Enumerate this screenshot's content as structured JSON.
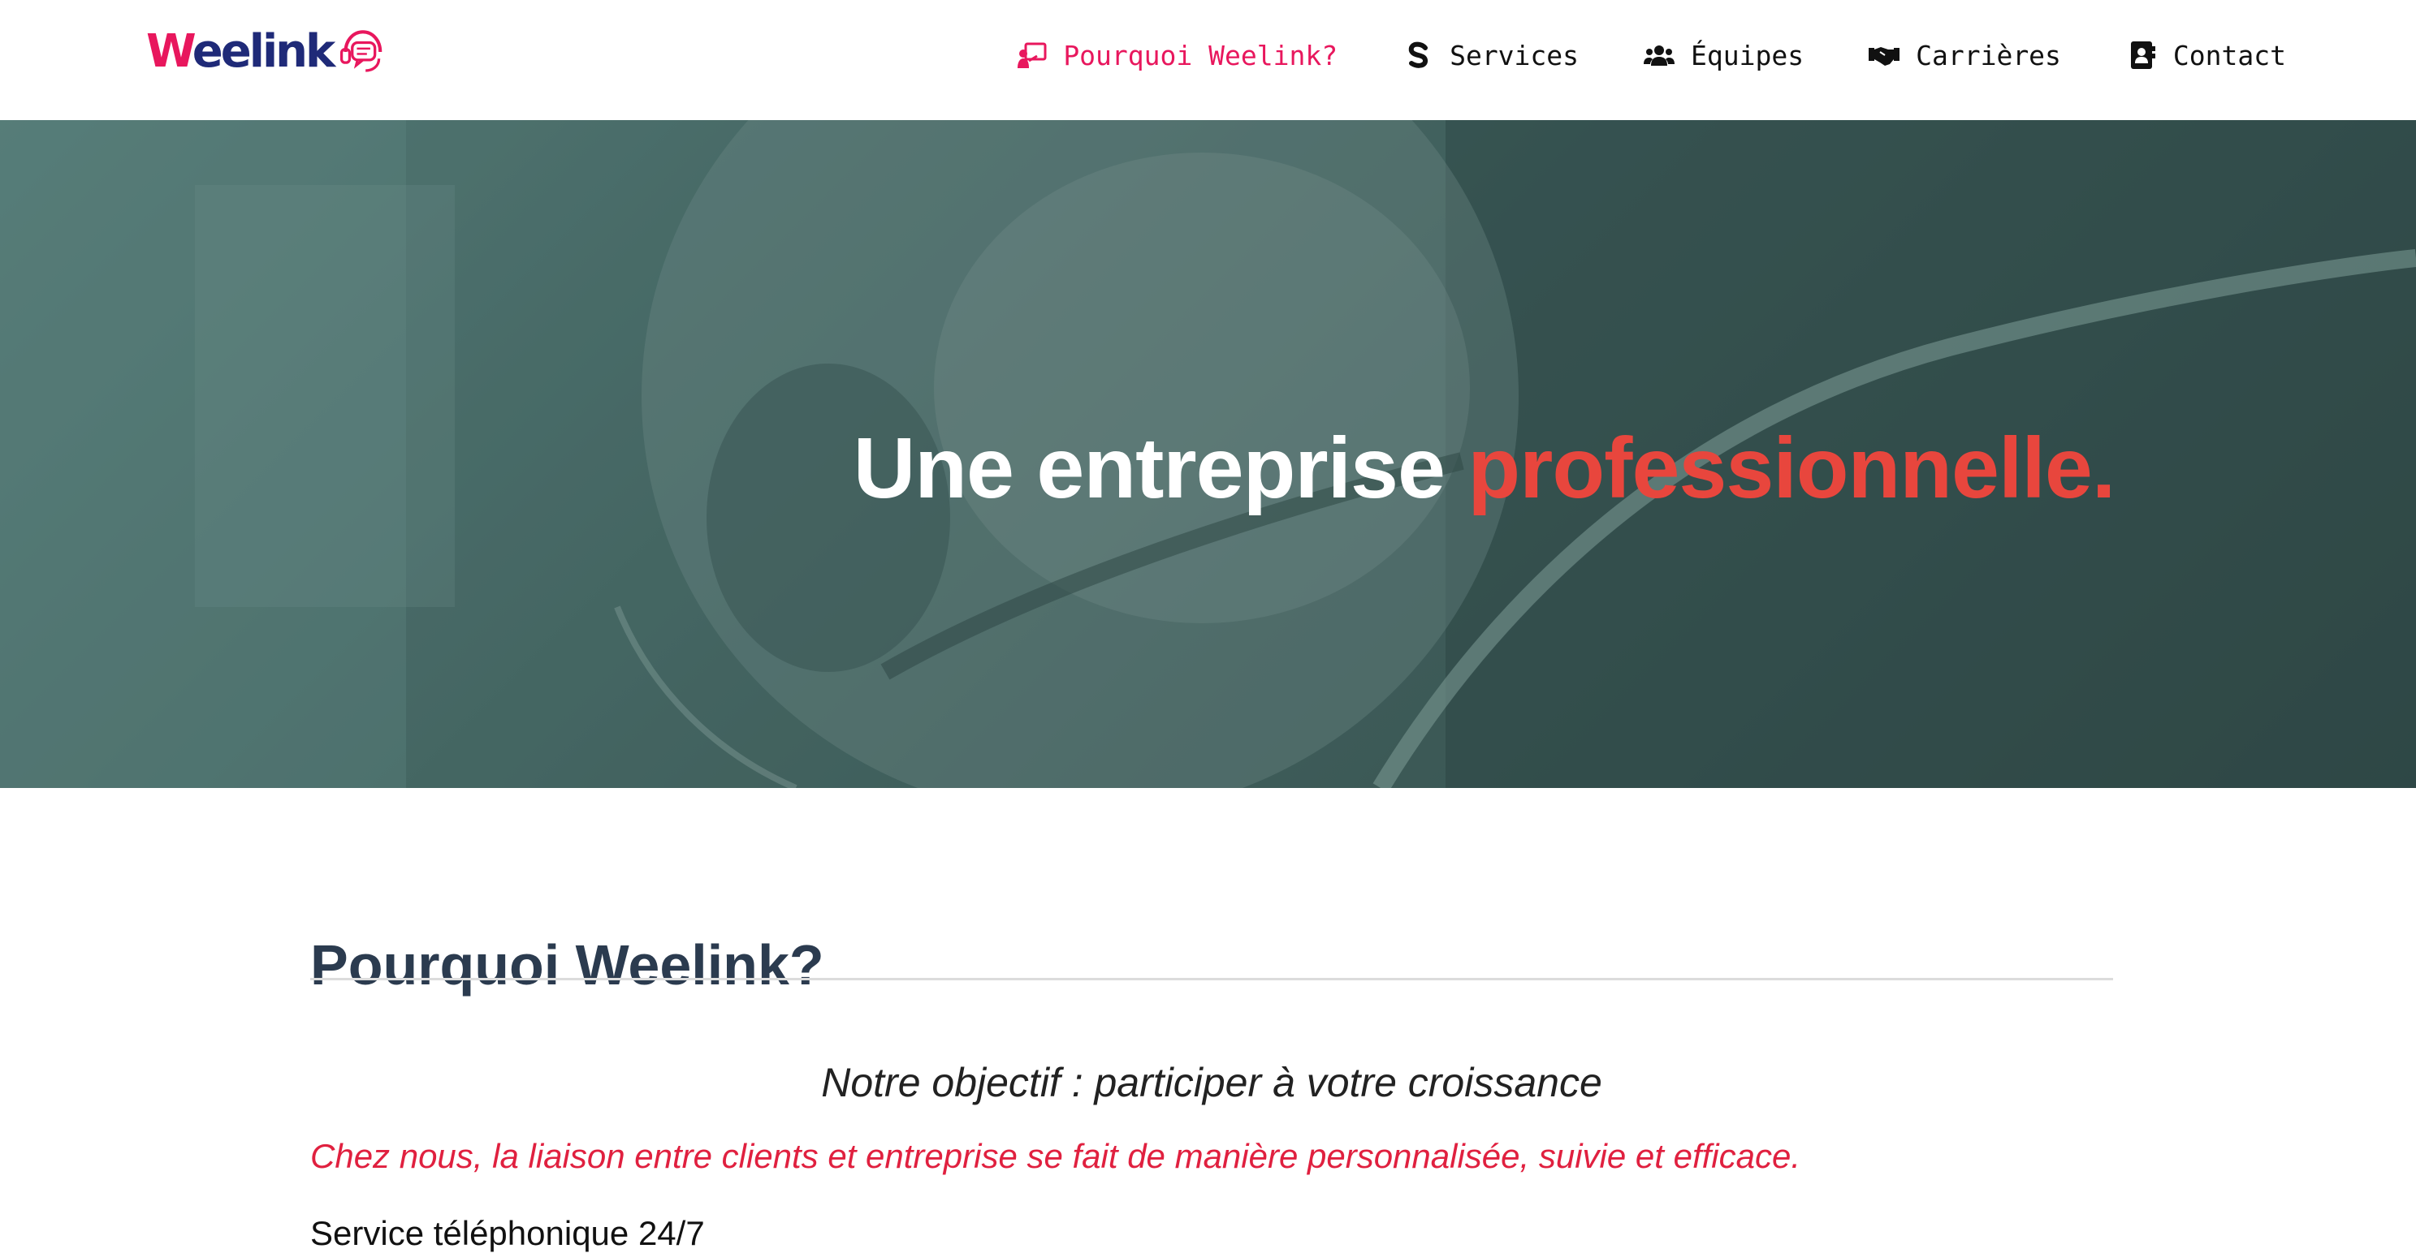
{
  "brand": {
    "logo_first": "W",
    "logo_rest": "eelink",
    "primary_color": "#e8175d",
    "secondary_color": "#1f2a78"
  },
  "nav": {
    "items": [
      {
        "label": "Pourquoi Weelink?",
        "icon": "teacher-board-icon",
        "active": true
      },
      {
        "label": "Services",
        "icon": "dollar-sign-icon",
        "active": false
      },
      {
        "label": "Équipes",
        "icon": "users-icon",
        "active": false
      },
      {
        "label": "Carrières",
        "icon": "handshake-icon",
        "active": false
      },
      {
        "label": "Contact",
        "icon": "address-book-icon",
        "active": false
      }
    ]
  },
  "hero": {
    "title_main": "Une entreprise ",
    "title_accent": "professionnelle.",
    "accent_color": "#e8463d"
  },
  "section": {
    "heading": "Pourquoi Weelink?",
    "objective": "Notre objectif : participer à votre croissance",
    "tagline": "Chez nous, la liaison entre clients et entreprise se fait de manière personnalisée, suivie et efficace.",
    "service_line": "Service téléphonique 24/7"
  }
}
